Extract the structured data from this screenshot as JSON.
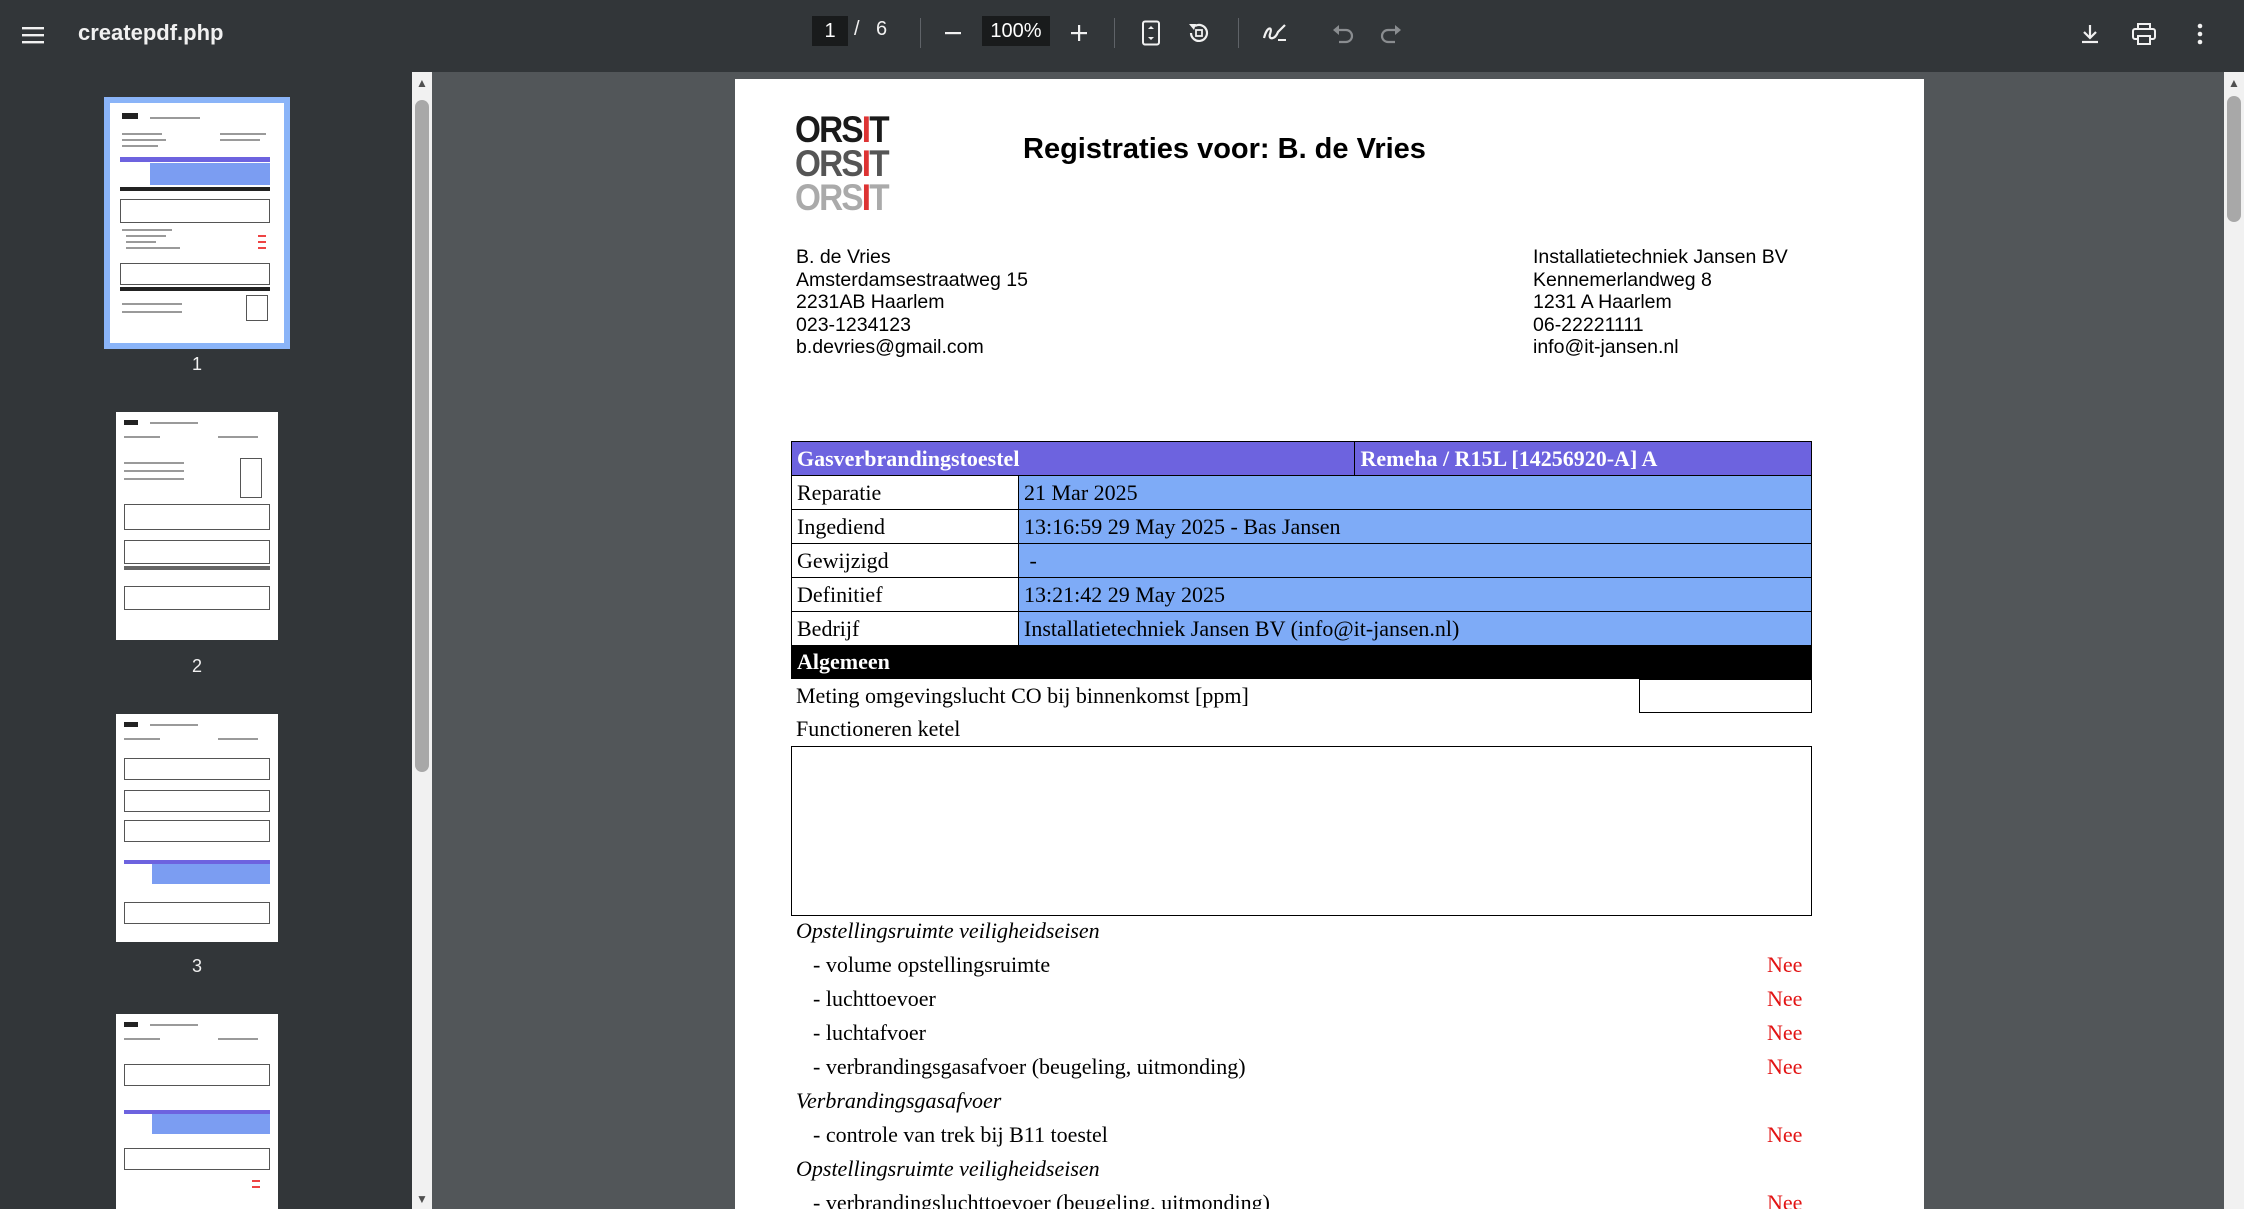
{
  "toolbar": {
    "title": "createpdf.php",
    "page_current": "1",
    "page_separator": "/",
    "page_total": "6",
    "zoom": "100%",
    "icons": [
      "menu-icon",
      "zoom-out-icon",
      "zoom-in-icon",
      "fit-page-icon",
      "rotate-icon",
      "annotate-icon",
      "undo-icon",
      "redo-icon",
      "download-icon",
      "print-icon",
      "more-icon"
    ]
  },
  "thumbnails": [
    {
      "label": "1"
    },
    {
      "label": "2"
    },
    {
      "label": "3"
    },
    {
      "label": ""
    }
  ],
  "document": {
    "logo": "ORSIT",
    "title": "Registraties voor: B. de Vries",
    "client": {
      "name": "B. de Vries",
      "street": "Amsterdamsestraatweg 15",
      "city": "2231AB Haarlem",
      "phone": "023-1234123",
      "email": "b.devries@gmail.com"
    },
    "company": {
      "name": "Installatietechniek Jansen BV",
      "street": "Kennemerlandweg 8",
      "city": "1231 A Haarlem",
      "phone": "06-22221111",
      "email": "info@it-jansen.nl"
    },
    "table": {
      "header_left": "Gasverbrandingstoestel",
      "header_right": "Remeha / R15L [14256920-A] A",
      "rows": [
        {
          "label": "Reparatie",
          "value": "21 Mar 2025"
        },
        {
          "label": "Ingediend",
          "value": "13:16:59 29 May 2025 - Bas Jansen"
        },
        {
          "label": "Gewijzigd",
          "value": " -"
        },
        {
          "label": "Definitief",
          "value": "13:21:42 29 May 2025"
        },
        {
          "label": "Bedrijf",
          "value": "Installatietechniek Jansen BV (info@it-jansen.nl)"
        }
      ]
    },
    "section_algemeen": "Algemeen",
    "co_label": "Meting omgevingslucht CO bij binnenkomst [ppm]",
    "func_label": "Functioneren ketel",
    "sections": [
      {
        "heading": "Opstellingsruimte veiligheidseisen",
        "items": [
          {
            "label": "- volume opstellingsruimte",
            "value": "Nee"
          },
          {
            "label": "- luchttoevoer",
            "value": "Nee"
          },
          {
            "label": "- luchtafvoer",
            "value": "Nee"
          },
          {
            "label": "- verbrandingsgasafvoer (beugeling, uitmonding)",
            "value": "Nee"
          }
        ]
      },
      {
        "heading": "Verbrandingsgasafvoer",
        "items": [
          {
            "label": "- controle van trek bij B11 toestel",
            "value": "Nee"
          }
        ]
      },
      {
        "heading": "Opstellingsruimte veiligheidseisen",
        "items": [
          {
            "label": "- verbrandingsluchttoevoer (beugeling, uitmonding)",
            "value": "Nee"
          }
        ]
      }
    ],
    "colors": {
      "header_purple": "#6d63df",
      "value_blue": "#7eabf7",
      "nee_red": "#e21414"
    }
  }
}
